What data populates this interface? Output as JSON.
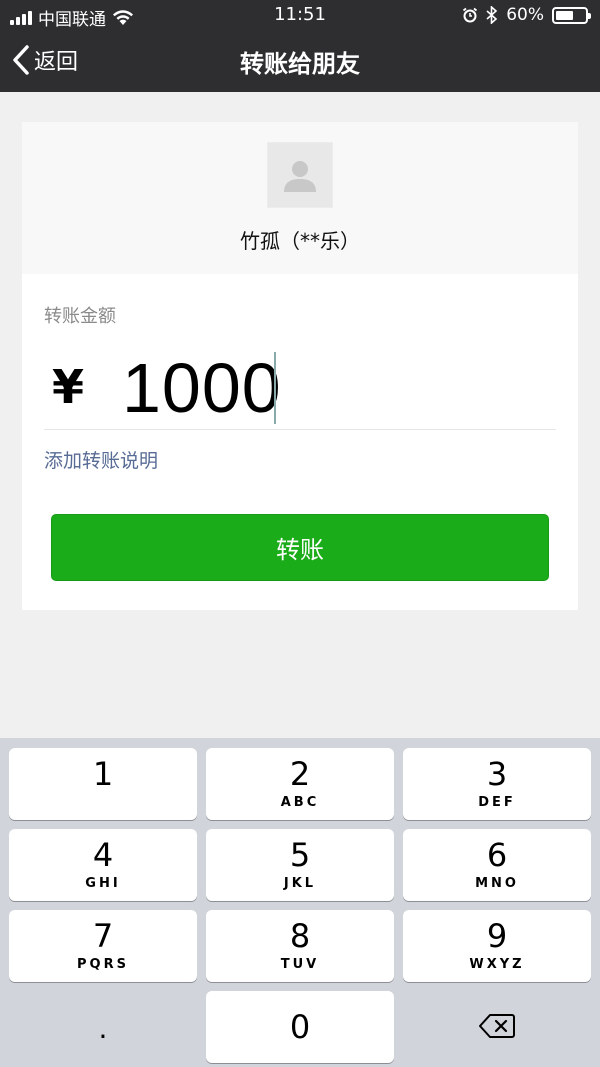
{
  "status": {
    "carrier": "中国联通",
    "time": "11:51",
    "battery": "60%",
    "battery_level": 0.6
  },
  "nav": {
    "back_label": "返回",
    "title": "转账给朋友"
  },
  "recipient": {
    "name": "竹孤（**乐）"
  },
  "amount": {
    "label": "转账金额",
    "currency": "¥",
    "value": "1000"
  },
  "note_link": "添加转账说明",
  "transfer_button": "转账",
  "keypad": {
    "keys": [
      {
        "num": "1",
        "letters": ""
      },
      {
        "num": "2",
        "letters": "ABC"
      },
      {
        "num": "3",
        "letters": "DEF"
      },
      {
        "num": "4",
        "letters": "GHI"
      },
      {
        "num": "5",
        "letters": "JKL"
      },
      {
        "num": "6",
        "letters": "MNO"
      },
      {
        "num": "7",
        "letters": "PQRS"
      },
      {
        "num": "8",
        "letters": "TUV"
      },
      {
        "num": "9",
        "letters": "WXYZ"
      },
      {
        "num": ".",
        "letters": ""
      },
      {
        "num": "0",
        "letters": ""
      }
    ]
  },
  "colors": {
    "nav_bg": "#2e2e31",
    "primary": "#1aad19",
    "link": "#576b95"
  },
  "icons": {
    "back": "chevron-left-icon",
    "delete": "backspace-icon",
    "avatar": "default-avatar-icon"
  }
}
